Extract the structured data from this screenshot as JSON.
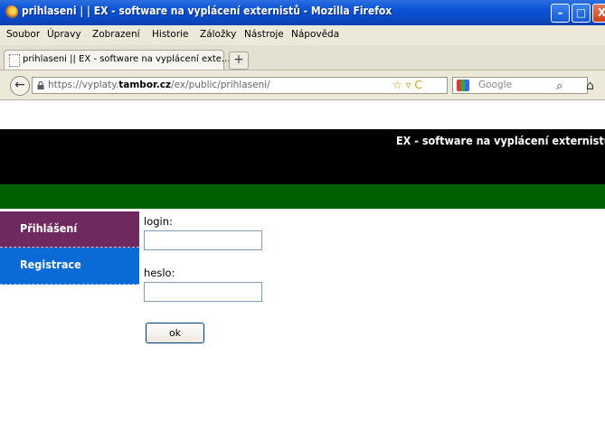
{
  "window": {
    "title": "prihlaseni | | EX - software na vyplácení externistů - Mozilla Firefox",
    "min_glyph": "–",
    "max_glyph": "□",
    "close_glyph": "X"
  },
  "menu": {
    "items": [
      "Soubor",
      "Úpravy",
      "Zobrazení",
      "Historie",
      "Záložky",
      "Nástroje",
      "Nápověda"
    ]
  },
  "tab": {
    "label": "prihlaseni || EX - software na vyplácení exte...",
    "new_tab_glyph": "+"
  },
  "nav": {
    "back_glyph": "←",
    "url_prefix": "https://vyplaty.",
    "url_domain": "tambor.cz",
    "url_path": "/ex/public/prihlaseni/",
    "url_icons": "☆ ▿ C",
    "search_placeholder": "Google",
    "search_glyph": "⌕",
    "home_glyph": "⌂"
  },
  "page": {
    "header_title": "EX - software na vyplácení externistů",
    "colors": {
      "header": "#000000",
      "band": "#006100",
      "menu_login": "#6e2a5e",
      "menu_registration": "#0a6ad6"
    },
    "sidebar": {
      "items": [
        {
          "label": "Přihlášení"
        },
        {
          "label": "Registrace"
        }
      ]
    },
    "form": {
      "login_label": "login:",
      "login_value": "",
      "password_label": "heslo:",
      "password_value": "",
      "submit_label": "ok"
    }
  }
}
